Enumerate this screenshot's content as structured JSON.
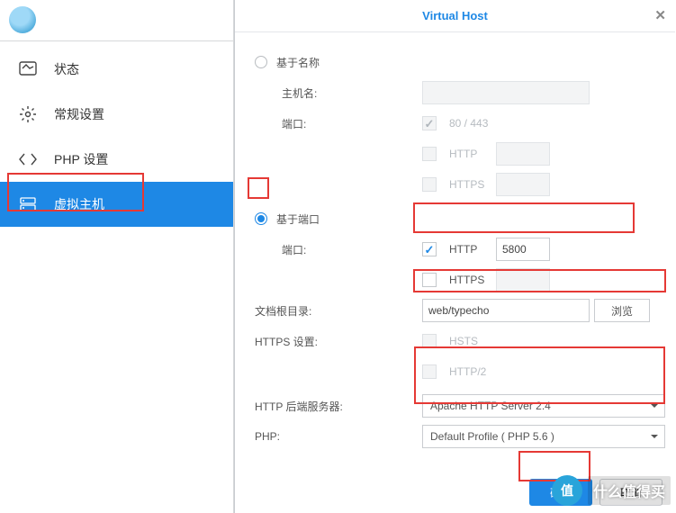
{
  "sidebar": {
    "items": [
      {
        "label": "状态"
      },
      {
        "label": "常规设置"
      },
      {
        "label": "PHP 设置"
      },
      {
        "label": "虚拟主机"
      }
    ]
  },
  "dialog": {
    "title": "Virtual Host",
    "option_name_based": "基于名称",
    "hostname_label": "主机名:",
    "port_label": "端口:",
    "default_ports": "80 / 443",
    "http_label": "HTTP",
    "https_label": "HTTPS",
    "option_port_based": "基于端口",
    "http_port": "5800",
    "https_port": "",
    "doc_root_label": "文档根目录:",
    "doc_root": "web/typecho",
    "browse_btn": "浏览",
    "https_settings_label": "HTTPS 设置:",
    "hsts_label": "HSTS",
    "http2_label": "HTTP/2",
    "backend_label": "HTTP 后端服务器:",
    "backend_value": "Apache HTTP Server 2.4",
    "php_label": "PHP:",
    "php_value": "Default Profile ( PHP 5.6 )",
    "ok_btn": "确定",
    "cancel_btn": "取消"
  },
  "watermark": {
    "badge": "值",
    "text": "什么值得买"
  }
}
